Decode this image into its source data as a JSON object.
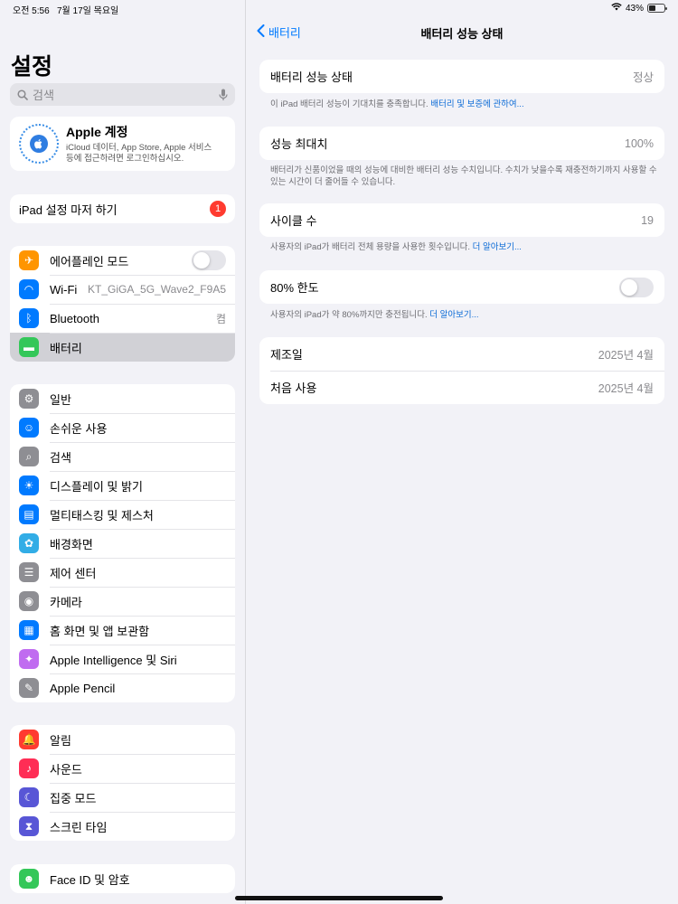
{
  "status": {
    "time": "오전 5:56",
    "date": "7월 17일 목요일",
    "battery_pct": "43%",
    "battery_level": 0.43
  },
  "sidebar": {
    "title": "설정",
    "search_placeholder": "검색",
    "account": {
      "name": "Apple 계정",
      "desc_line1": "iCloud 데이터, App Store, Apple 서비스",
      "desc_line2": "등에 접근하려면 로그인하십시오."
    },
    "setup": {
      "label": "iPad 설정 마저 하기",
      "badge": "1"
    },
    "group1": [
      {
        "label": "에어플레인 모드",
        "icon": "airplane-icon",
        "color": "#ff9500",
        "type": "toggle",
        "on": false
      },
      {
        "label": "Wi-Fi",
        "icon": "wifi-icon",
        "color": "#007aff",
        "value": "KT_GiGA_5G_Wave2_F9A5"
      },
      {
        "label": "Bluetooth",
        "icon": "bluetooth-icon",
        "color": "#007aff",
        "value": "켬"
      },
      {
        "label": "배터리",
        "icon": "battery-icon",
        "color": "#34c759",
        "selected": true
      }
    ],
    "group2": [
      {
        "label": "일반",
        "icon": "gear-icon",
        "color": "#8e8e93"
      },
      {
        "label": "손쉬운 사용",
        "icon": "accessibility-icon",
        "color": "#007aff"
      },
      {
        "label": "검색",
        "icon": "search-icon",
        "color": "#8e8e93"
      },
      {
        "label": "디스플레이 및 밝기",
        "icon": "brightness-icon",
        "color": "#007aff"
      },
      {
        "label": "멀티태스킹 및 제스처",
        "icon": "multitasking-icon",
        "color": "#007aff"
      },
      {
        "label": "배경화면",
        "icon": "wallpaper-icon",
        "color": "#32ade6"
      },
      {
        "label": "제어 센터",
        "icon": "control-center-icon",
        "color": "#8e8e93"
      },
      {
        "label": "카메라",
        "icon": "camera-icon",
        "color": "#8e8e93"
      },
      {
        "label": "홈 화면 및 앱 보관함",
        "icon": "home-screen-icon",
        "color": "#007aff"
      },
      {
        "label": "Apple Intelligence 및 Siri",
        "icon": "siri-icon",
        "color": "#c06cf0"
      },
      {
        "label": "Apple Pencil",
        "icon": "pencil-icon",
        "color": "#8e8e93"
      }
    ],
    "group3": [
      {
        "label": "알림",
        "icon": "notification-icon",
        "color": "#ff3b30"
      },
      {
        "label": "사운드",
        "icon": "sound-icon",
        "color": "#ff2d55"
      },
      {
        "label": "집중 모드",
        "icon": "moon-icon",
        "color": "#5856d6"
      },
      {
        "label": "스크린 타임",
        "icon": "hourglass-icon",
        "color": "#5856d6"
      }
    ],
    "group4": [
      {
        "label": "Face ID 및 암호",
        "icon": "face-id-icon",
        "color": "#34c759"
      }
    ]
  },
  "detail": {
    "back_label": "배터리",
    "title": "배터리 성능 상태",
    "health": {
      "label": "배터리 성능 상태",
      "value": "정상",
      "foot": "이 iPad 배터리 성능이 기대치를 충족합니다.",
      "foot_link": "배터리 및 보증에 관하여..."
    },
    "max_capacity": {
      "label": "성능 최대치",
      "value": "100%",
      "foot": "배터리가 신품이었을 때의 성능에 대비한 배터리 성능 수치입니다. 수치가 낮을수록 재충전하기까지 사용할 수 있는 시간이 더 줄어들 수 있습니다."
    },
    "cycle": {
      "label": "사이클 수",
      "value": "19",
      "foot": "사용자의 iPad가 배터리 전체 용량을 사용한 횟수입니다.",
      "foot_link": "더 알아보기..."
    },
    "limit": {
      "label": "80% 한도",
      "on": false,
      "foot": "사용자의 iPad가 약 80%까지만 충전됩니다.",
      "foot_link": "더 알아보기..."
    },
    "manufacture": {
      "label": "제조일",
      "value": "2025년 4월"
    },
    "first_use": {
      "label": "처음 사용",
      "value": "2025년 4월"
    }
  }
}
